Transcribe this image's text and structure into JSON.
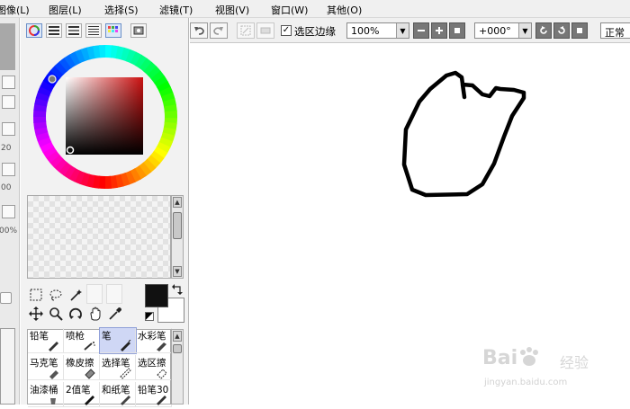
{
  "menu": {
    "items": [
      "图像(L)",
      "图层(L)",
      "选择(S)",
      "滤镜(T)",
      "视图(V)",
      "窗口(W)",
      "其他(O)"
    ]
  },
  "left_strip": {
    "values": [
      "20",
      "00",
      "00%"
    ]
  },
  "panel": {
    "tabs": [
      "color-wheel-icon",
      "list-icon",
      "list-icon",
      "list-icon",
      "palette-grid-icon",
      "swatch-icon"
    ],
    "tools": [
      "rect-select-icon",
      "lasso-icon",
      "magic-wand-icon",
      "move-icon",
      "zoom-icon",
      "rotate-icon",
      "hand-icon",
      "eyedropper-icon"
    ],
    "foreground_color": "#111111",
    "background_color": "#ffffff",
    "brushes": [
      {
        "label": "铅笔",
        "icon": "pencil-icon"
      },
      {
        "label": "喷枪",
        "icon": "airbrush-icon"
      },
      {
        "label": "笔",
        "icon": "pen-icon"
      },
      {
        "label": "水彩笔",
        "icon": "watercolor-icon"
      },
      {
        "label": "马克笔",
        "icon": "marker-icon"
      },
      {
        "label": "橡皮擦",
        "icon": "eraser-icon"
      },
      {
        "label": "选择笔",
        "icon": "select-pen-icon"
      },
      {
        "label": "选区擦",
        "icon": "select-eraser-icon"
      },
      {
        "label": "油漆桶",
        "icon": "bucket-icon"
      },
      {
        "label": "2值笔",
        "icon": "binary-pen-icon"
      },
      {
        "label": "和纸笔",
        "icon": "washi-pen-icon"
      },
      {
        "label": "铅笔30",
        "icon": "pencil-icon"
      }
    ],
    "selected_brush": "笔"
  },
  "toolbar": {
    "undo_icon": "undo-icon",
    "redo_icon": "redo-icon",
    "selection_edge_label": "选区边缘",
    "selection_edge_checked": true,
    "zoom_value": "100%",
    "rotation_value": "+000°",
    "blend_mode": "正常"
  },
  "watermark": {
    "brand": "Bai",
    "brand2": "经验",
    "url": "jingyan.baidu.com"
  },
  "colors": {
    "selected_brush_bg": "#cfd7f5",
    "stroke": "#000000",
    "panel_bg": "#f2f2f2"
  }
}
